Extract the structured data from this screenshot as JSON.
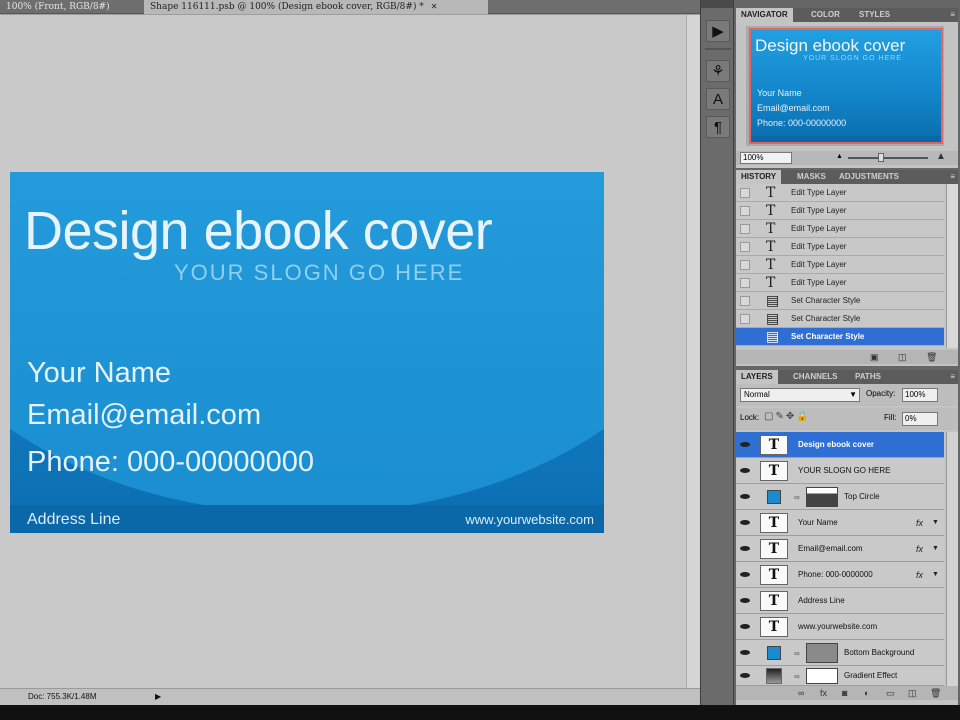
{
  "document_tabs": [
    {
      "label": "100% (Front, RGB/8#)"
    },
    {
      "label": "Shape 116111.psb @ 100% (Design ebook cover, RGB/8#) *"
    }
  ],
  "card": {
    "title": "Design ebook cover",
    "slogan": "YOUR SLOGN GO HERE",
    "name": "Your Name",
    "email": "Email@email.com",
    "phone": "Phone: 000-00000000",
    "address": "Address Line",
    "website": "www.yourwebsite.com"
  },
  "statusbar": {
    "doc_info": "Doc: 755.3K/1.48M"
  },
  "tools": [
    {
      "icon": "play-panel-icon",
      "glyph": "▶"
    },
    {
      "icon": "clone-source-icon",
      "glyph": "⚘"
    },
    {
      "icon": "character-icon",
      "glyph": "A"
    },
    {
      "icon": "paragraph-icon",
      "glyph": "¶"
    }
  ],
  "navigator": {
    "tabs": [
      "NAVIGATOR",
      "COLOR",
      "STYLES"
    ],
    "zoom": "100%",
    "thumb": {
      "title": "Design ebook cover",
      "slogan": "YOUR SLOGN GO HERE",
      "name": "Your Name",
      "email": "Email@email.com",
      "phone": "Phone: 000-00000000"
    }
  },
  "history": {
    "tabs": [
      "HISTORY",
      "MASKS",
      "ADJUSTMENTS"
    ],
    "items": [
      {
        "label": "Edit Type Layer",
        "icon": "T"
      },
      {
        "label": "Edit Type Layer",
        "icon": "T"
      },
      {
        "label": "Edit Type Layer",
        "icon": "T"
      },
      {
        "label": "Edit Type Layer",
        "icon": "T"
      },
      {
        "label": "Edit Type Layer",
        "icon": "T"
      },
      {
        "label": "Edit Type Layer",
        "icon": "T"
      },
      {
        "label": "Set Character Style",
        "icon": "▤"
      },
      {
        "label": "Set Character Style",
        "icon": "▤"
      },
      {
        "label": "Set Character Style",
        "icon": "▤"
      }
    ],
    "selected_index": 8
  },
  "layers": {
    "tabs": [
      "LAYERS",
      "CHANNELS",
      "PATHS"
    ],
    "blend_mode": "Normal",
    "opacity_label": "Opacity:",
    "opacity": "100%",
    "lock_label": "Lock:",
    "fill_label": "Fill:",
    "fill": "0%",
    "items": [
      {
        "name": "Design ebook cover",
        "kind": "text",
        "fx": false,
        "selected": true
      },
      {
        "name": "YOUR SLOGN GO HERE",
        "kind": "text",
        "fx": false,
        "selected": false
      },
      {
        "name": "Top Circle",
        "kind": "shape",
        "fx": false,
        "selected": false
      },
      {
        "name": "Your Name",
        "kind": "text",
        "fx": true,
        "selected": false
      },
      {
        "name": "Email@email.com",
        "kind": "text",
        "fx": true,
        "selected": false
      },
      {
        "name": "Phone: 000-0000000",
        "kind": "text",
        "fx": true,
        "selected": false
      },
      {
        "name": "Address Line",
        "kind": "text",
        "fx": false,
        "selected": false
      },
      {
        "name": "www.yourwebsite.com",
        "kind": "text",
        "fx": false,
        "selected": false
      },
      {
        "name": "Bottom Background",
        "kind": "fill",
        "fx": false,
        "selected": false
      },
      {
        "name": "Gradient Effect",
        "kind": "gradient",
        "fx": false,
        "selected": false
      }
    ]
  },
  "colors": {
    "card_blue": "#1585ca",
    "selection": "#2f6fd4",
    "nav_frame": "#e56363"
  }
}
